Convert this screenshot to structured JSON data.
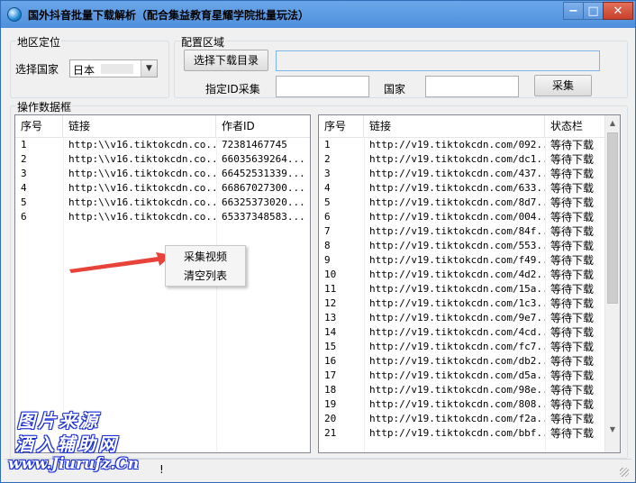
{
  "window": {
    "title": "国外抖音批量下载解析（配合集益教育星耀学院批量玩法）",
    "buttons": {
      "minimize": "−",
      "maximize": "□",
      "close": "✕"
    }
  },
  "region": {
    "group_label": "地区定位",
    "country_label": "选择国家",
    "country_value": "日本"
  },
  "config": {
    "group_label": "配置区域",
    "choose_dir_button": "选择下载目录",
    "dir_path": "",
    "specified_id_label": "指定ID采集",
    "specified_id_value": "",
    "country_label": "国家",
    "country_value": "",
    "collect_button": "采集"
  },
  "ops_group_label": "操作数据框",
  "left_list": {
    "columns": [
      "序号",
      "链接",
      "作者ID"
    ],
    "rows": [
      [
        "1",
        "http:\\\\v16.tiktokcdn.co...",
        "72381467745"
      ],
      [
        "2",
        "http:\\\\v16.tiktokcdn.co...",
        "66035639264..."
      ],
      [
        "3",
        "http:\\\\v16.tiktokcdn.co...",
        "66452531339..."
      ],
      [
        "4",
        "http:\\\\v16.tiktokcdn.co...",
        "66867027300..."
      ],
      [
        "5",
        "http:\\\\v16.tiktokcdn.co...",
        "66325373020..."
      ],
      [
        "6",
        "http:\\\\v16.tiktokcdn.co...",
        "65337348583..."
      ]
    ]
  },
  "right_list": {
    "columns": [
      "序号",
      "链接",
      "状态栏"
    ],
    "rows": [
      [
        "1",
        "http://v19.tiktokcdn.com/092...",
        "等待下载"
      ],
      [
        "2",
        "http://v19.tiktokcdn.com/dc1...",
        "等待下载"
      ],
      [
        "3",
        "http://v19.tiktokcdn.com/437...",
        "等待下载"
      ],
      [
        "4",
        "http://v19.tiktokcdn.com/633...",
        "等待下载"
      ],
      [
        "5",
        "http://v19.tiktokcdn.com/8d7...",
        "等待下载"
      ],
      [
        "6",
        "http://v19.tiktokcdn.com/004...",
        "等待下载"
      ],
      [
        "7",
        "http://v19.tiktokcdn.com/84f...",
        "等待下载"
      ],
      [
        "8",
        "http://v19.tiktokcdn.com/553...",
        "等待下载"
      ],
      [
        "9",
        "http://v19.tiktokcdn.com/f49...",
        "等待下载"
      ],
      [
        "10",
        "http://v19.tiktokcdn.com/4d2...",
        "等待下载"
      ],
      [
        "11",
        "http://v19.tiktokcdn.com/15a...",
        "等待下载"
      ],
      [
        "12",
        "http://v19.tiktokcdn.com/1c3...",
        "等待下载"
      ],
      [
        "13",
        "http://v19.tiktokcdn.com/9e7...",
        "等待下载"
      ],
      [
        "14",
        "http://v19.tiktokcdn.com/4cd...",
        "等待下载"
      ],
      [
        "15",
        "http://v19.tiktokcdn.com/fc7...",
        "等待下载"
      ],
      [
        "16",
        "http://v19.tiktokcdn.com/db2...",
        "等待下载"
      ],
      [
        "17",
        "http://v19.tiktokcdn.com/d5a...",
        "等待下载"
      ],
      [
        "18",
        "http://v19.tiktokcdn.com/98e...",
        "等待下载"
      ],
      [
        "19",
        "http://v19.tiktokcdn.com/808...",
        "等待下载"
      ],
      [
        "20",
        "http://v19.tiktokcdn.com/f2a...",
        "等待下载"
      ],
      [
        "21",
        "http://v19.tiktokcdn.com/bbf...",
        "等待下载"
      ]
    ]
  },
  "context_menu": {
    "items": [
      "采集视频",
      "清空列表"
    ]
  },
  "status": {
    "text": "!"
  },
  "watermark": {
    "line1": "图片来源",
    "line2": "酒入辅助网",
    "line3": "www.Jiurufz.Cn"
  },
  "colors": {
    "title_bar": "#5b97de",
    "arrow": "#e8433a",
    "close_button": "#c8402b",
    "watermark_outline": "#1b2fd6"
  }
}
